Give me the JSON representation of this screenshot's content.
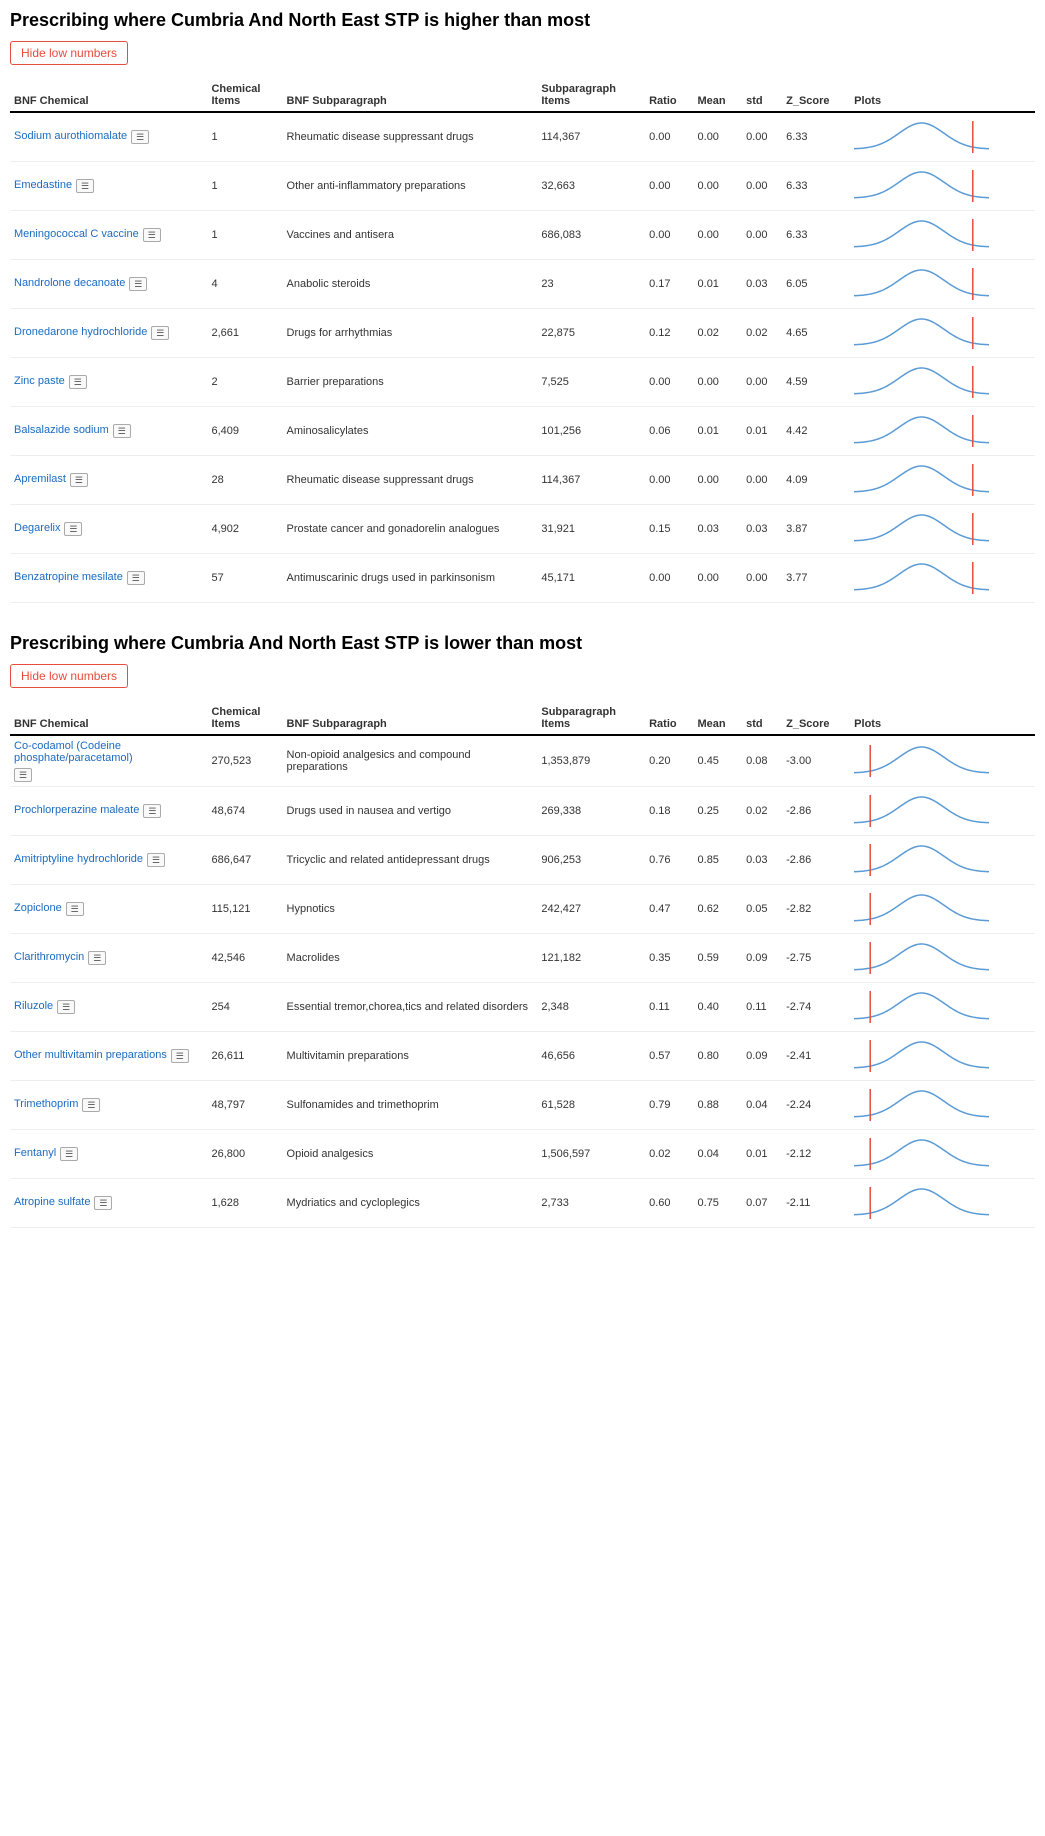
{
  "section1": {
    "title": "Prescribing where Cumbria And North East STP is higher than most",
    "hideBtn": "Hide low numbers",
    "columns": {
      "bnfChem": "BNF Chemical",
      "chemItems": "Chemical Items",
      "bnfSub": "BNF Subparagraph",
      "subItems": "Subparagraph Items",
      "ratio": "Ratio",
      "mean": "Mean",
      "std": "std",
      "zScore": "Z_Score",
      "plots": "Plots"
    },
    "rows": [
      {
        "chemical": "Sodium aurothiomalate",
        "chemItems": "1",
        "subparagraph": "Rheumatic disease suppressant drugs",
        "subItems": "114,367",
        "ratio": "0.00",
        "mean": "0.00",
        "std": "0.00",
        "zscore": "6.33"
      },
      {
        "chemical": "Emedastine",
        "chemItems": "1",
        "subparagraph": "Other anti-inflammatory preparations",
        "subItems": "32,663",
        "ratio": "0.00",
        "mean": "0.00",
        "std": "0.00",
        "zscore": "6.33"
      },
      {
        "chemical": "Meningococcal C vaccine",
        "chemItems": "1",
        "subparagraph": "Vaccines and antisera",
        "subItems": "686,083",
        "ratio": "0.00",
        "mean": "0.00",
        "std": "0.00",
        "zscore": "6.33"
      },
      {
        "chemical": "Nandrolone decanoate",
        "chemItems": "4",
        "subparagraph": "Anabolic steroids",
        "subItems": "23",
        "ratio": "0.17",
        "mean": "0.01",
        "std": "0.03",
        "zscore": "6.05"
      },
      {
        "chemical": "Dronedarone hydrochloride",
        "chemItems": "2,661",
        "subparagraph": "Drugs for arrhythmias",
        "subItems": "22,875",
        "ratio": "0.12",
        "mean": "0.02",
        "std": "0.02",
        "zscore": "4.65"
      },
      {
        "chemical": "Zinc paste",
        "chemItems": "2",
        "subparagraph": "Barrier preparations",
        "subItems": "7,525",
        "ratio": "0.00",
        "mean": "0.00",
        "std": "0.00",
        "zscore": "4.59"
      },
      {
        "chemical": "Balsalazide sodium",
        "chemItems": "6,409",
        "subparagraph": "Aminosalicylates",
        "subItems": "101,256",
        "ratio": "0.06",
        "mean": "0.01",
        "std": "0.01",
        "zscore": "4.42"
      },
      {
        "chemical": "Apremilast",
        "chemItems": "28",
        "subparagraph": "Rheumatic disease suppressant drugs",
        "subItems": "114,367",
        "ratio": "0.00",
        "mean": "0.00",
        "std": "0.00",
        "zscore": "4.09"
      },
      {
        "chemical": "Degarelix",
        "chemItems": "4,902",
        "subparagraph": "Prostate cancer and gonadorelin analogues",
        "subItems": "31,921",
        "ratio": "0.15",
        "mean": "0.03",
        "std": "0.03",
        "zscore": "3.87"
      },
      {
        "chemical": "Benzatropine mesilate",
        "chemItems": "57",
        "subparagraph": "Antimuscarinic drugs used in parkinsonism",
        "subItems": "45,171",
        "ratio": "0.00",
        "mean": "0.00",
        "std": "0.00",
        "zscore": "3.77"
      }
    ]
  },
  "section2": {
    "title": "Prescribing where Cumbria And North East STP is lower than most",
    "hideBtn": "Hide low numbers",
    "rows": [
      {
        "chemical": "Co-codamol (Codeine phosphate/paracetamol)",
        "chemItems": "270,523",
        "subparagraph": "Non-opioid analgesics and compound preparations",
        "subItems": "1,353,879",
        "ratio": "0.20",
        "mean": "0.45",
        "std": "0.08",
        "zscore": "-3.00"
      },
      {
        "chemical": "Prochlorperazine maleate",
        "chemItems": "48,674",
        "subparagraph": "Drugs used in nausea and vertigo",
        "subItems": "269,338",
        "ratio": "0.18",
        "mean": "0.25",
        "std": "0.02",
        "zscore": "-2.86"
      },
      {
        "chemical": "Amitriptyline hydrochloride",
        "chemItems": "686,647",
        "subparagraph": "Tricyclic and related antidepressant drugs",
        "subItems": "906,253",
        "ratio": "0.76",
        "mean": "0.85",
        "std": "0.03",
        "zscore": "-2.86"
      },
      {
        "chemical": "Zopiclone",
        "chemItems": "115,121",
        "subparagraph": "Hypnotics",
        "subItems": "242,427",
        "ratio": "0.47",
        "mean": "0.62",
        "std": "0.05",
        "zscore": "-2.82"
      },
      {
        "chemical": "Clarithromycin",
        "chemItems": "42,546",
        "subparagraph": "Macrolides",
        "subItems": "121,182",
        "ratio": "0.35",
        "mean": "0.59",
        "std": "0.09",
        "zscore": "-2.75"
      },
      {
        "chemical": "Riluzole",
        "chemItems": "254",
        "subparagraph": "Essential tremor,chorea,tics and related disorders",
        "subItems": "2,348",
        "ratio": "0.11",
        "mean": "0.40",
        "std": "0.11",
        "zscore": "-2.74"
      },
      {
        "chemical": "Other multivitamin preparations",
        "chemItems": "26,611",
        "subparagraph": "Multivitamin preparations",
        "subItems": "46,656",
        "ratio": "0.57",
        "mean": "0.80",
        "std": "0.09",
        "zscore": "-2.41"
      },
      {
        "chemical": "Trimethoprim",
        "chemItems": "48,797",
        "subparagraph": "Sulfonamides and trimethoprim",
        "subItems": "61,528",
        "ratio": "0.79",
        "mean": "0.88",
        "std": "0.04",
        "zscore": "-2.24"
      },
      {
        "chemical": "Fentanyl",
        "chemItems": "26,800",
        "subparagraph": "Opioid analgesics",
        "subItems": "1,506,597",
        "ratio": "0.02",
        "mean": "0.04",
        "std": "0.01",
        "zscore": "-2.12"
      },
      {
        "chemical": "Atropine sulfate",
        "chemItems": "1,628",
        "subparagraph": "Mydriatics and cycloplegics",
        "subItems": "2,733",
        "ratio": "0.60",
        "mean": "0.75",
        "std": "0.07",
        "zscore": "-2.11"
      }
    ]
  }
}
